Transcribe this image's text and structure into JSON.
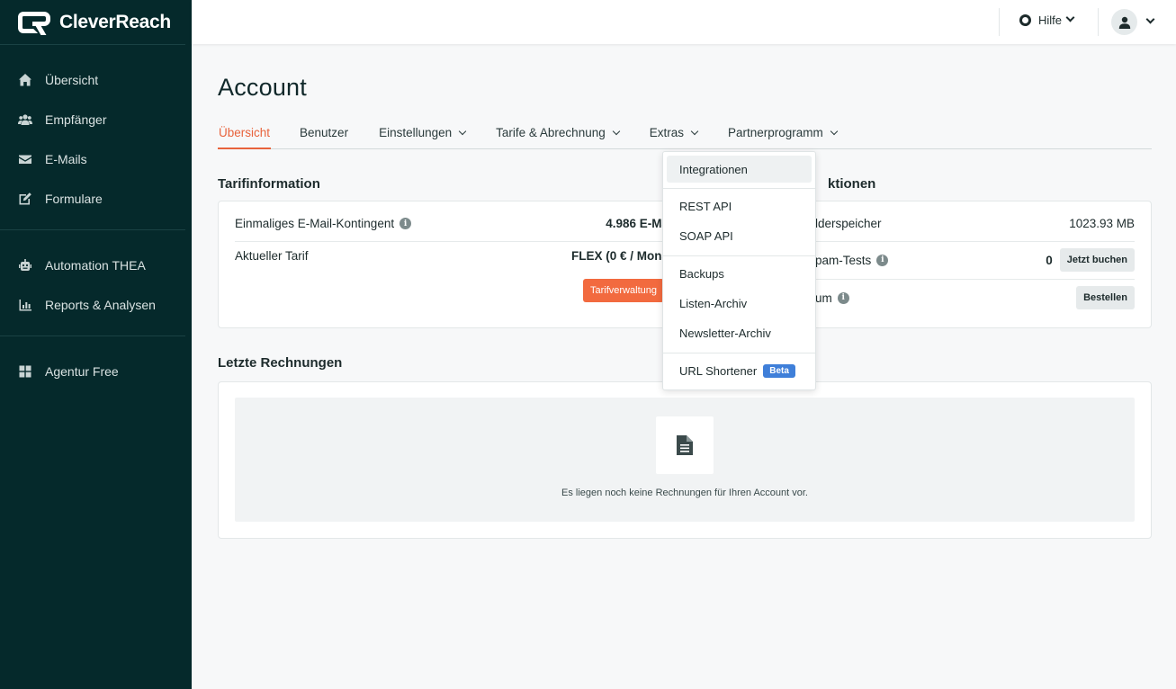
{
  "brand": {
    "name": "CleverReach"
  },
  "sidebar": {
    "groups": [
      {
        "items": [
          {
            "label": "Übersicht",
            "icon": "home-icon"
          },
          {
            "label": "Empfänger",
            "icon": "users-icon"
          },
          {
            "label": "E-Mails",
            "icon": "envelope-icon"
          },
          {
            "label": "Formulare",
            "icon": "form-edit-icon"
          }
        ]
      },
      {
        "items": [
          {
            "label": "Automation THEA",
            "icon": "robot-icon"
          },
          {
            "label": "Reports & Analysen",
            "icon": "chart-icon"
          }
        ]
      },
      {
        "items": [
          {
            "label": "Agentur Free",
            "icon": "grid-icon"
          }
        ]
      }
    ]
  },
  "topbar": {
    "help_label": "Hilfe"
  },
  "page": {
    "title": "Account",
    "tabs": [
      {
        "label": "Übersicht",
        "active": true,
        "dropdown": false
      },
      {
        "label": "Benutzer",
        "active": false,
        "dropdown": false
      },
      {
        "label": "Einstellungen",
        "active": false,
        "dropdown": true
      },
      {
        "label": "Tarife & Abrechnung",
        "active": false,
        "dropdown": true
      },
      {
        "label": "Extras",
        "active": false,
        "dropdown": true
      },
      {
        "label": "Partnerprogramm",
        "active": false,
        "dropdown": true
      }
    ]
  },
  "tarif": {
    "title": "Tarifinformation",
    "rows": [
      {
        "label": "Einmaliges E-Mail-Kontingent",
        "value": "4.986 E-Ma"
      },
      {
        "label": "Aktueller Tarif",
        "value": "FLEX (0 € / Mona"
      }
    ],
    "button": "Tarifverwaltung"
  },
  "aktionen": {
    "title": "ktionen",
    "rows": [
      {
        "label": "lderspeicher",
        "value": "1023.93 MB"
      },
      {
        "label": "pam-Tests",
        "value": "0",
        "button": "Jetzt buchen"
      },
      {
        "label": "um",
        "value": "",
        "button": "Bestellen"
      }
    ]
  },
  "rechnungen": {
    "title": "Letzte Rechnungen",
    "empty_text": "Es liegen noch keine Rechnungen für Ihren Account vor."
  },
  "extras_menu": {
    "items": [
      {
        "label": "Integrationen"
      },
      {
        "label": "REST API"
      },
      {
        "label": "SOAP API"
      },
      {
        "label": "Backups"
      },
      {
        "label": "Listen-Archiv"
      },
      {
        "label": "Newsletter-Archiv"
      },
      {
        "label": "URL Shortener",
        "badge": "Beta"
      }
    ]
  },
  "colors": {
    "sidebar": "#05292b",
    "accent": "#e8633c",
    "button": "#f26a3f",
    "badge": "#3f7fd9"
  }
}
